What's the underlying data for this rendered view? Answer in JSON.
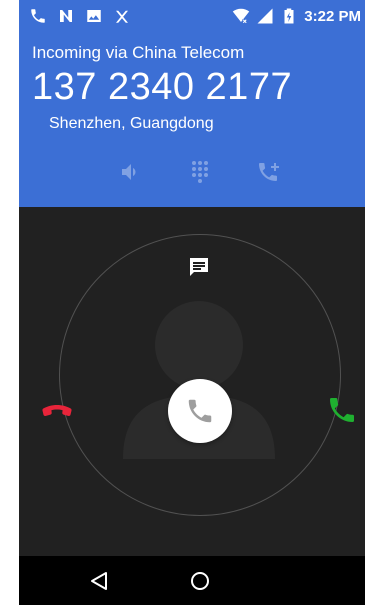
{
  "status_bar": {
    "time": "3:22 PM",
    "left_icons": [
      "missed-call-icon",
      "n-notification-icon",
      "image-icon",
      "voicemail-icon"
    ],
    "right_icons": [
      "wifi-icon",
      "signal-icon",
      "battery-icon"
    ]
  },
  "call": {
    "via": "Incoming via China Telecom",
    "number": "137 2340 2177",
    "location": "Shenzhen, Guangdong"
  },
  "actions": [
    {
      "icon": "speaker-icon"
    },
    {
      "icon": "dialpad-icon"
    },
    {
      "icon": "add-call-icon"
    }
  ],
  "colors": {
    "header": "#3c6fd5",
    "body": "#212121",
    "decline": "#e8243a",
    "accept": "#1fb030"
  },
  "navigation": {
    "back": "back-icon",
    "home": "home-icon"
  }
}
